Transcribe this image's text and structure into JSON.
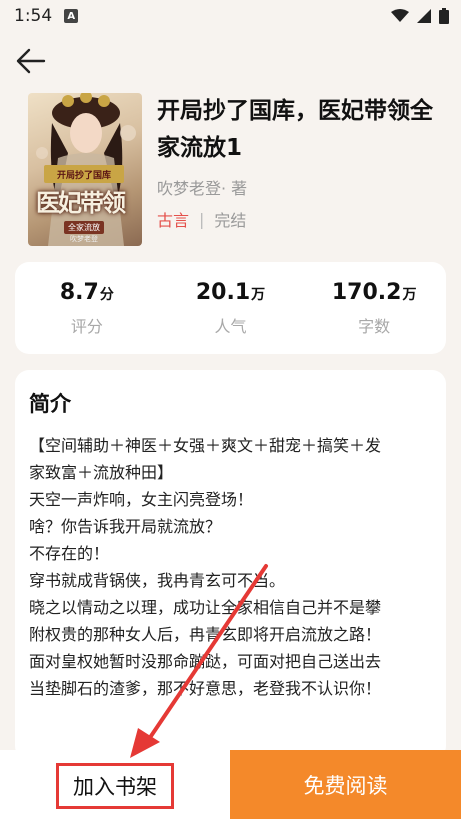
{
  "status_bar": {
    "time": "1:54",
    "notification_icon": "A",
    "icons": [
      "wifi-icon",
      "signal-icon",
      "battery-icon"
    ]
  },
  "header": {
    "back_icon": "arrow-left-icon"
  },
  "book": {
    "cover": {
      "small_title": "开局抄了国库",
      "big_title": "医妃带领",
      "subtitle": "全家流放",
      "author_mark": "吹梦老登"
    },
    "title": "开局抄了国库，医妃带领全家流放1",
    "author": "吹梦老登· 著",
    "genre": "古言",
    "separator": "|",
    "status": "完结"
  },
  "stats": [
    {
      "value": "8.7",
      "unit": "分",
      "label": "评分"
    },
    {
      "value": "20.1",
      "unit": "万",
      "label": "人气"
    },
    {
      "value": "170.2",
      "unit": "万",
      "label": "字数"
    }
  ],
  "intro": {
    "heading": "简介",
    "lines": [
      "【空间辅助＋神医＋女强＋爽文＋甜宠＋搞笑＋发",
      "家致富＋流放种田】",
      "天空一声炸响，女主闪亮登场！",
      "啥？你告诉我开局就流放？",
      "不存在的！",
      "穿书就成背锅侠，我冉青玄可不当。",
      "晓之以情动之以理，成功让全家相信自己并不是攀",
      "附权贵的那种女人后，冉青玄即将开启流放之路！",
      "面对皇权她暂时没那命蹦跶，可面对把自己送出去",
      "当垫脚石的渣爹，那不好意思，老登我不认识你！"
    ]
  },
  "bottom": {
    "add_to_shelf": "加入书架",
    "read_free": "免费阅读"
  },
  "colors": {
    "accent_orange": "#f4892a",
    "genre_red": "#e4504b",
    "annotation_red": "#e53935"
  }
}
